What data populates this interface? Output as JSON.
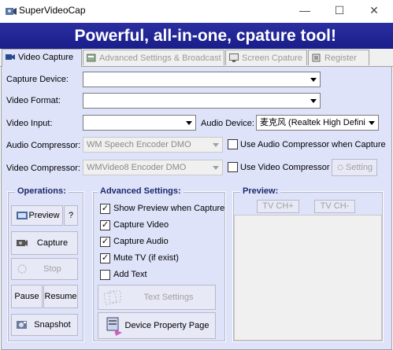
{
  "window": {
    "title": "SuperVideoCap",
    "minimize": "—",
    "maximize": "☐",
    "close": "✕"
  },
  "banner": {
    "text": "Powerful, all-in-one, cpature tool!"
  },
  "tabs": [
    {
      "label": "Video Capture",
      "icon": "video-capture-icon"
    },
    {
      "label": "Advanced Settings & Broadcast",
      "icon": "settings-icon"
    },
    {
      "label": "Screen Cpature",
      "icon": "screen-icon"
    },
    {
      "label": "Register",
      "icon": "register-icon"
    }
  ],
  "form": {
    "capture_device_label": "Capture Device:",
    "capture_device_value": "",
    "video_format_label": "Video Format:",
    "video_format_value": "",
    "video_input_label": "Video Input:",
    "video_input_value": "",
    "audio_device_label": "Audio Device:",
    "audio_device_value": "麦克风 (Realtek High Defini",
    "audio_compressor_label": "Audio Compressor:",
    "audio_compressor_value": "WM Speech Encoder DMO",
    "use_audio_compressor_label": "Use Audio Compressor when Capture",
    "video_compressor_label": "Video Compressor:",
    "video_compressor_value": "WMVideo8 Encoder DMO",
    "use_video_compressor_label": "Use Video Compressor",
    "setting_button": "Setting"
  },
  "operations": {
    "title": "Operations:",
    "preview": "Preview",
    "help": "?",
    "capture": "Capture",
    "stop": "Stop",
    "pause": "Pause",
    "resume": "Resume",
    "snapshot": "Snapshot"
  },
  "advanced": {
    "title": "Advanced Settings:",
    "show_preview": "Show Preview when Capture",
    "capture_video": "Capture Video",
    "capture_audio": "Capture Audio",
    "mute_tv": "Mute TV (if exist)",
    "add_text": "Add Text",
    "text_settings": "Text Settings",
    "device_property": "Device Property Page",
    "checks": {
      "show_preview": true,
      "capture_video": true,
      "capture_audio": true,
      "mute_tv": true,
      "add_text": false
    }
  },
  "preview": {
    "title": "Preview:",
    "ch_plus": "TV CH+",
    "ch_minus": "TV CH-"
  }
}
